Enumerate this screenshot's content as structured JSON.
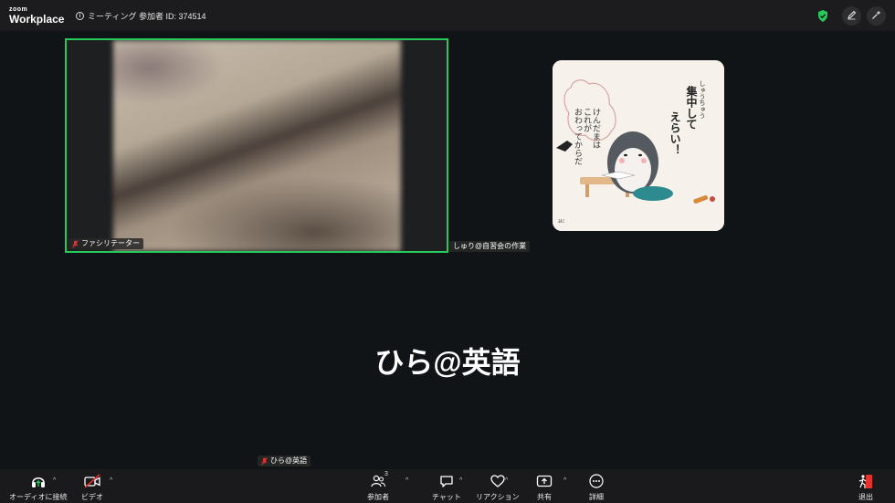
{
  "titlebar": {
    "logo_small": "zoom",
    "logo_big": "Workplace",
    "meeting_info": "ミーティング 参加者 ID: 374514",
    "shield_color": "#27c95a"
  },
  "video": {
    "main_tile_name": "ファシリテーター",
    "side_tile_name": "しゅり@自習会の作業",
    "active_speaker_border": "#27c95a",
    "art": {
      "vertical_text_1": "しゅうちゅう",
      "vertical_text_2": "集中して",
      "vertical_text_3": "えらい！",
      "bubble_text_1": "けんだまは",
      "bubble_text_2": "これが",
      "bubble_text_3": "おわってからだ"
    }
  },
  "center": {
    "display_name": "ひら@英語",
    "self_name_pill": "ひら@英語"
  },
  "toolbar": {
    "audio_label": "オーディオに接続",
    "video_label": "ビデオ",
    "participants_label": "参加者",
    "participants_count": "3",
    "chat_label": "チャット",
    "reaction_label": "リアクション",
    "share_label": "共有",
    "more_label": "詳細",
    "leave_label": "退出",
    "accent_green": "#27c95a",
    "accent_red": "#e5322d"
  }
}
